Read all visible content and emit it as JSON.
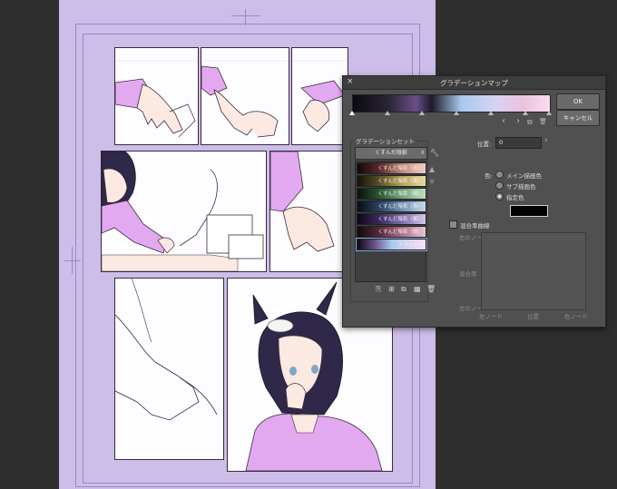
{
  "dialog": {
    "title": "グラデーションマップ",
    "close_label": "×",
    "ok_label": "OK",
    "cancel_label": "キャンセル",
    "nav": {
      "prev": "‹",
      "next": "›",
      "add": "⧉",
      "delete": "🗑"
    },
    "gradient_set": {
      "section_label": "グラデーションセット",
      "selected": "くすんだ陰影",
      "items": [
        {
          "label": "くすんだ陰影（赤）",
          "gradient": "linear-gradient(to right,#120808,#5e2b2b,#c58b7d,#efd0c4)"
        },
        {
          "label": "くすんだ陰影（黄）",
          "gradient": "linear-gradient(to right,#141208,#5b5227,#b7a65a,#e8dca4)"
        },
        {
          "label": "くすんだ陰影（緑）",
          "gradient": "linear-gradient(to right,#081208,#2c5a35,#6ea77b,#c2e0c0)"
        },
        {
          "label": "くすんだ陰影（青）",
          "gradient": "linear-gradient(to right,#080d16,#2a4463,#6f93b8,#c6d9ea)"
        },
        {
          "label": "くすんだ陰影（紫）",
          "gradient": "linear-gradient(to right,#0d0815,#3b2c5c,#7f6fae,#d3c8ea)"
        },
        {
          "label": "くすんだ陰影（桃）",
          "gradient": "linear-gradient(to right,#14080d,#5a2a40,#b1708e,#eac3d5)"
        },
        {
          "label": "フラッシュ",
          "gradient": "linear-gradient(to right,#0b0a10,#6a4f8a,#a7c9ee,#d6d3f2,#fbdcec)"
        }
      ],
      "up_icon": "▲",
      "down_icon": "▼"
    },
    "position": {
      "label": "位置:",
      "value": "0"
    },
    "color": {
      "label": "色:",
      "options": [
        "メイン描画色",
        "サブ描画色",
        "指定色"
      ],
      "selected_index": 2,
      "specified_color": "#030303"
    },
    "mix_curve": {
      "label": "混合率曲線",
      "checked": false,
      "right_node": "右のノード",
      "mix_rate": "混合率",
      "left_node": "左のノード",
      "bottom_left": "左ノード",
      "bottom_mid": "位置",
      "bottom_right": "右ノード"
    }
  },
  "colors": {
    "page": "#cdbde9",
    "workspace": "#2e2e2e",
    "dialog_bg": "#505050",
    "hair": "#2f2848",
    "skin": "#fbe9e2",
    "sweater": "#e3a9f0"
  }
}
